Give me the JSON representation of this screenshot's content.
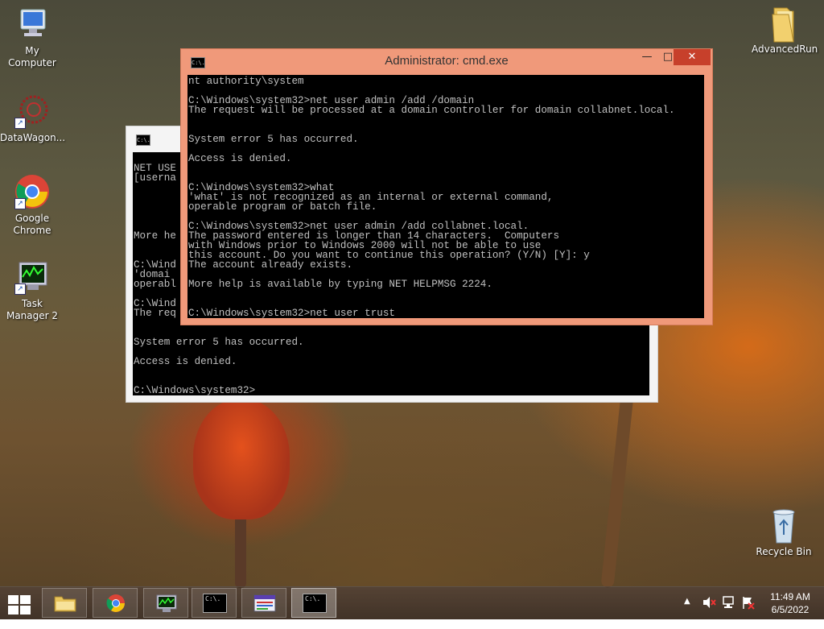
{
  "desktop": {
    "icons": [
      {
        "label": "My Computer",
        "icon": "computer-icon"
      },
      {
        "label": "DataWagon...",
        "icon": "datawagon-icon"
      },
      {
        "label": "Google Chrome",
        "icon": "chrome-icon"
      },
      {
        "label": "Task Manager 2",
        "icon": "task-manager-icon"
      },
      {
        "label": "AdvancedRun",
        "icon": "folder-icon"
      },
      {
        "label": "Recycle Bin",
        "icon": "recycle-bin-icon"
      }
    ]
  },
  "front_window": {
    "title": "Administrator: cmd.exe",
    "icon_text": "C:\\.",
    "min": "—",
    "max": "□",
    "close": "✕",
    "console_text": "nt authority\\system\n\nC:\\Windows\\system32>net user admin /add /domain\nThe request will be processed at a domain controller for domain collabnet.local.\n\n\nSystem error 5 has occurred.\n\nAccess is denied.\n\n\nC:\\Windows\\system32>what\n'what' is not recognized as an internal or external command,\noperable program or batch file.\n\nC:\\Windows\\system32>net user admin /add collabnet.local.\nThe password entered is longer than 14 characters.  Computers\nwith Windows prior to Windows 2000 will not be able to use\nthis account. Do you want to continue this operation? (Y/N) [Y]: y\nThe account already exists.\n\nMore help is available by typing NET HELPMSG 2224.\n\n\nC:\\Windows\\system32>net user trust"
  },
  "back_window": {
    "icon_text": "C:\\.",
    "console_text": "\nNET USE\n[userna\n\n\n\n\n\nMore he\n\n\nC:\\Wind\n'domai\noperabl\n\nC:\\Wind\nThe req\n\n\nSystem error 5 has occurred.\n\nAccess is denied.\n\n\nC:\\Windows\\system32>"
  },
  "taskbar": {
    "buttons": [
      {
        "name": "file-explorer",
        "icon": "folder-icon"
      },
      {
        "name": "chrome",
        "icon": "chrome-icon"
      },
      {
        "name": "task-manager",
        "icon": "task-manager-icon"
      },
      {
        "name": "cmd-1",
        "icon": "cmd-icon"
      },
      {
        "name": "app-window",
        "icon": "app-window-icon"
      },
      {
        "name": "cmd-2",
        "icon": "cmd-icon",
        "active": true
      }
    ],
    "cmd_icon_text": "C:\\.",
    "tray": {
      "show_hidden": "▲",
      "time": "11:49 AM",
      "date": "6/5/2022"
    }
  }
}
